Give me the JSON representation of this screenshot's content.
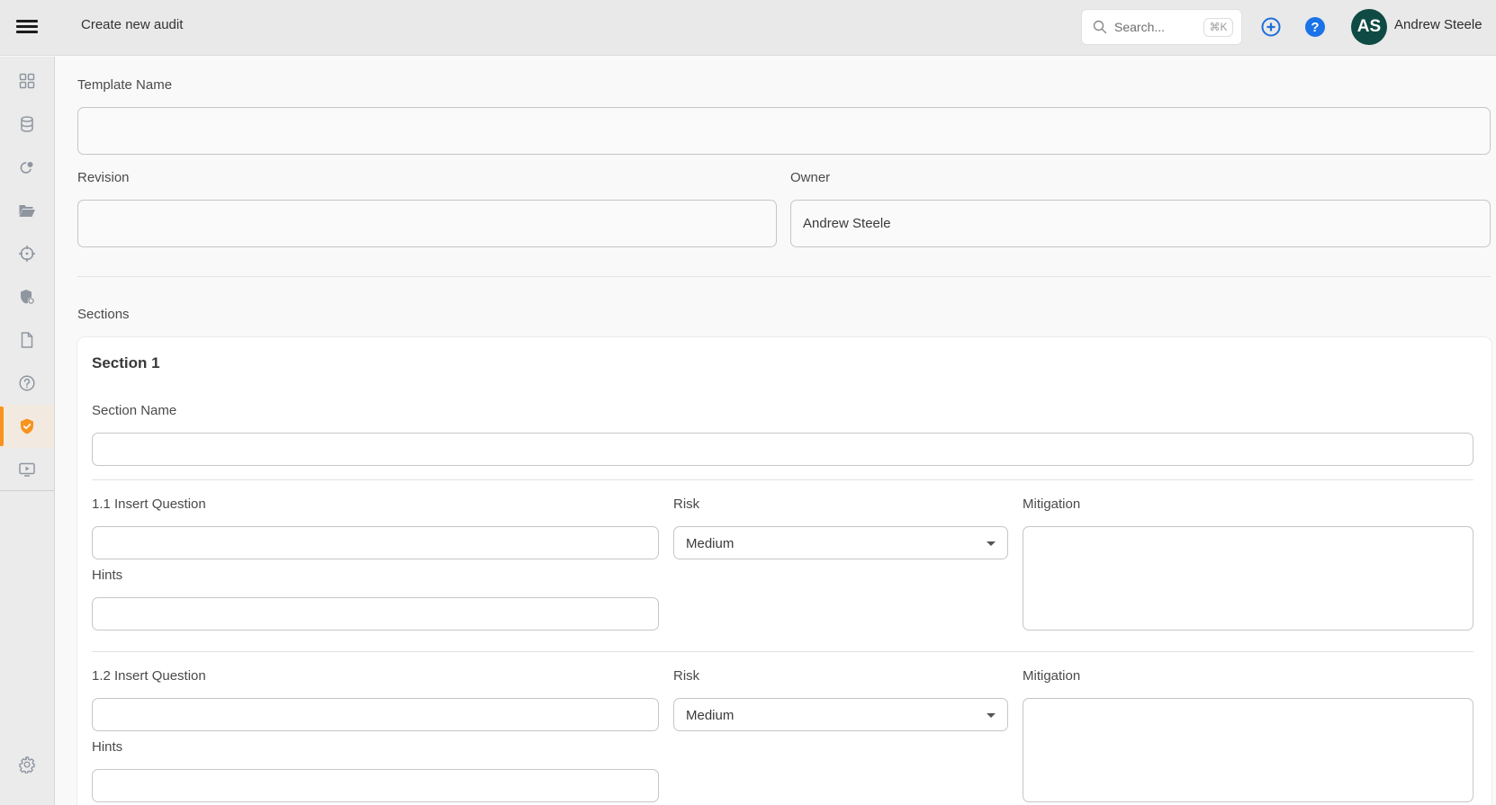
{
  "header": {
    "title": "Create new audit",
    "search_placeholder": "Search...",
    "search_shortcut": "⌘K",
    "user_initials": "AS",
    "user_name": "Andrew Steele",
    "colors": {
      "add": "#1e6fd9",
      "help": "#1a73e8",
      "avatar_bg": "#0f4a44"
    }
  },
  "sidebar": {
    "active_color": "#f7931e",
    "items": [
      {
        "name": "dashboard",
        "icon": "grid-icon"
      },
      {
        "name": "database",
        "icon": "database-icon"
      },
      {
        "name": "activity",
        "icon": "refresh-dot-icon"
      },
      {
        "name": "documents-folder",
        "icon": "folder-open-icon"
      },
      {
        "name": "target",
        "icon": "crosshair-icon"
      },
      {
        "name": "security-settings",
        "icon": "shield-gear-icon"
      },
      {
        "name": "files",
        "icon": "file-icon"
      },
      {
        "name": "help",
        "icon": "question-circle-icon"
      },
      {
        "name": "audits",
        "icon": "shield-check-icon",
        "active": true
      },
      {
        "name": "media",
        "icon": "presentation-play-icon"
      }
    ],
    "settings_icon": "gear-icon"
  },
  "form": {
    "template_name": {
      "label": "Template Name",
      "value": ""
    },
    "revision": {
      "label": "Revision",
      "value": ""
    },
    "owner": {
      "label": "Owner",
      "value": "Andrew Steele"
    },
    "sections_label": "Sections",
    "sections": [
      {
        "title": "Section 1",
        "name_label": "Section Name",
        "name_value": "",
        "questions": [
          {
            "question_label": "1.1 Insert Question",
            "question_value": "",
            "hints_label": "Hints",
            "hints_value": "",
            "risk_label": "Risk",
            "risk_value": "Medium",
            "mitigation_label": "Mitigation",
            "mitigation_value": ""
          },
          {
            "question_label": "1.2 Insert Question",
            "question_value": "",
            "hints_label": "Hints",
            "hints_value": "",
            "risk_label": "Risk",
            "risk_value": "Medium",
            "mitigation_label": "Mitigation",
            "mitigation_value": ""
          }
        ]
      }
    ]
  }
}
